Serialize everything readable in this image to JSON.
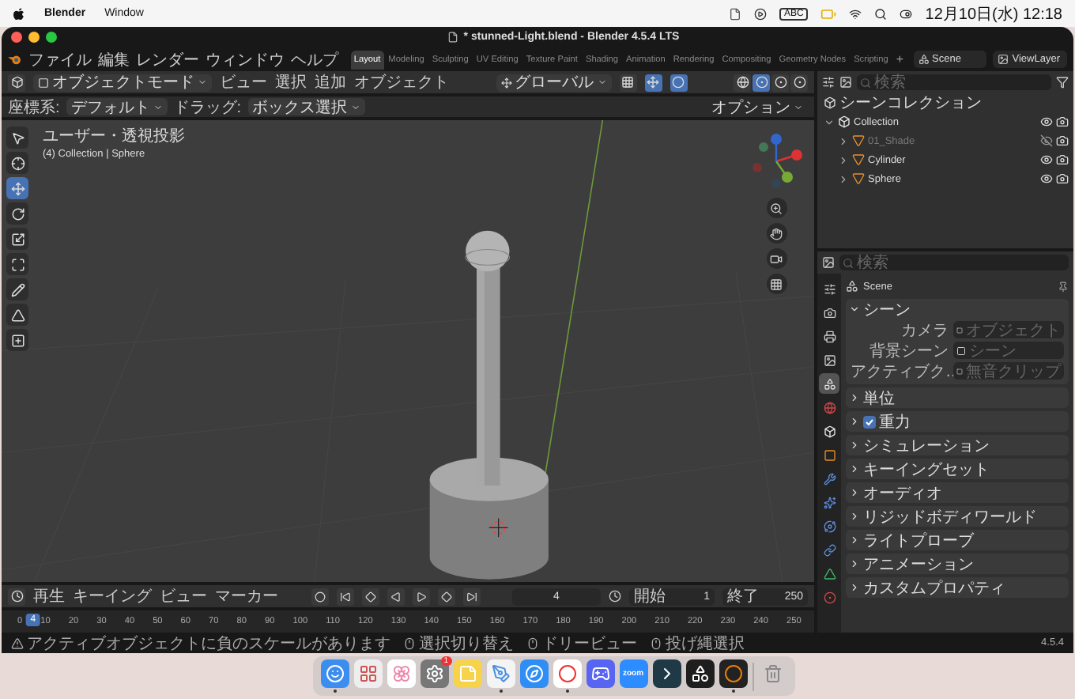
{
  "menubar": {
    "app": "Blender",
    "menus": [
      "Window"
    ],
    "input": "ABC",
    "clock": "12月10日(水) 12:18"
  },
  "window": {
    "title": "* stunned-Light.blend - Blender 4.5.4 LTS"
  },
  "topbar": {
    "menus": [
      "ファイル",
      "編集",
      "レンダー",
      "ウィンドウ",
      "ヘルプ"
    ],
    "workspaces": [
      {
        "label": "Layout",
        "selected": true
      },
      {
        "label": "Modeling",
        "selected": false
      },
      {
        "label": "Sculpting",
        "selected": false
      },
      {
        "label": "UV Editing",
        "selected": false
      },
      {
        "label": "Texture Paint",
        "selected": false
      },
      {
        "label": "Shading",
        "selected": false
      },
      {
        "label": "Animation",
        "selected": false
      },
      {
        "label": "Rendering",
        "selected": false
      },
      {
        "label": "Compositing",
        "selected": false
      },
      {
        "label": "Geometry Nodes",
        "selected": false
      },
      {
        "label": "Scripting",
        "selected": false
      }
    ],
    "add": "+",
    "scene": "Scene",
    "view_layer": "ViewLayer"
  },
  "viewport": {
    "mode": "オブジェクトモード",
    "menus": [
      "ビュー",
      "選択",
      "追加",
      "オブジェクト"
    ],
    "orientation": "グローバル",
    "shading": [
      {
        "kind": "wire",
        "selected": false
      },
      {
        "kind": "solid",
        "selected": true
      },
      {
        "kind": "material",
        "selected": false
      },
      {
        "kind": "rendered",
        "selected": false
      }
    ],
    "tool_settings": {
      "coord_label": "座標系:",
      "coord_value": "デフォルト",
      "drag_label": "ドラッグ:",
      "drag_value": "ボックス選択",
      "options": "オプション"
    },
    "overlay": {
      "view": "ユーザー・透視投影",
      "context": "(4) Collection | Sphere"
    },
    "tools": [
      {
        "kind": "select",
        "selected": false
      },
      {
        "kind": "cursor",
        "selected": false
      },
      {
        "kind": "move",
        "selected": true
      },
      {
        "kind": "rotate",
        "selected": false
      },
      {
        "kind": "scale",
        "selected": false
      },
      {
        "kind": "transform",
        "selected": false
      },
      {
        "kind": "annotate",
        "selected": false
      },
      {
        "kind": "measure",
        "selected": false
      },
      {
        "kind": "add",
        "selected": false
      }
    ]
  },
  "outliner": {
    "search_placeholder": "検索",
    "root": "シーンコレクション",
    "items": [
      {
        "name": "Collection",
        "expanded": true,
        "hidden": false,
        "children": [
          {
            "name": "01_Shade",
            "expanded": false,
            "hidden": true
          },
          {
            "name": "Cylinder",
            "expanded": false,
            "hidden": false
          },
          {
            "name": "Sphere",
            "expanded": false,
            "hidden": false
          }
        ]
      }
    ]
  },
  "properties": {
    "search_placeholder": "検索",
    "context": "Scene",
    "tabs": [
      {
        "kind": "tool",
        "selected": false
      },
      {
        "kind": "render",
        "selected": false
      },
      {
        "kind": "output",
        "selected": false
      },
      {
        "kind": "view_layer",
        "selected": false
      },
      {
        "kind": "scene",
        "selected": true
      },
      {
        "kind": "world",
        "selected": false
      },
      {
        "kind": "collection",
        "selected": false
      },
      {
        "kind": "object",
        "selected": false
      },
      {
        "kind": "modifiers",
        "selected": false
      },
      {
        "kind": "particles",
        "selected": false
      },
      {
        "kind": "physics",
        "selected": false
      },
      {
        "kind": "constraints",
        "selected": false
      },
      {
        "kind": "data",
        "selected": false
      },
      {
        "kind": "material",
        "selected": false
      }
    ],
    "section": {
      "title": "シーン",
      "expanded": true,
      "fields": [
        {
          "label": "カメラ",
          "placeholder": "オブジェクト"
        },
        {
          "label": "背景シーン",
          "placeholder": "シーン"
        },
        {
          "label": "アクティブク…",
          "placeholder": "無音クリップ"
        }
      ]
    },
    "panels": [
      {
        "title": "単位",
        "kind": "plain",
        "expanded": false
      },
      {
        "title": "重力",
        "kind": "checkbox",
        "checked": true,
        "expanded": false
      },
      {
        "title": "シミュレーション",
        "kind": "plain",
        "expanded": false
      },
      {
        "title": "キーイングセット",
        "kind": "plain",
        "expanded": false
      },
      {
        "title": "オーディオ",
        "kind": "plain",
        "expanded": false
      },
      {
        "title": "リジッドボディワールド",
        "kind": "plain",
        "expanded": false
      },
      {
        "title": "ライトプローブ",
        "kind": "plain",
        "expanded": false
      },
      {
        "title": "アニメーション",
        "kind": "plain",
        "expanded": false
      },
      {
        "title": "カスタムプロパティ",
        "kind": "plain",
        "expanded": false
      }
    ]
  },
  "timeline": {
    "menus": [
      "再生",
      "キーイング",
      "ビュー",
      "マーカー"
    ],
    "current_frame": "4",
    "start_label": "開始",
    "start": "1",
    "end_label": "終了",
    "end": "250",
    "playhead": "4",
    "ticks": [
      "0",
      "10",
      "20",
      "30",
      "40",
      "50",
      "60",
      "70",
      "80",
      "90",
      "100",
      "110",
      "120",
      "130",
      "140",
      "150",
      "160",
      "170",
      "180",
      "190",
      "200",
      "210",
      "220",
      "230",
      "240",
      "250"
    ]
  },
  "status_bar": {
    "items": [
      {
        "kind": "warning",
        "text": "アクティブオブジェクトに負のスケールがあります"
      },
      {
        "kind": "mouse",
        "text": "選択切り替え"
      },
      {
        "kind": "mouse",
        "text": "ドリービュー"
      },
      {
        "kind": "mouse",
        "text": "投げ縄選択"
      }
    ],
    "version": "4.5.4"
  },
  "dock": {
    "apps": [
      {
        "kind": "finder",
        "running": true
      },
      {
        "kind": "launchpad",
        "running": false
      },
      {
        "kind": "photos",
        "running": false
      },
      {
        "kind": "settings",
        "running": false,
        "badge": "1"
      },
      {
        "kind": "notes",
        "running": false
      },
      {
        "kind": "freeform",
        "running": true
      },
      {
        "kind": "safari",
        "running": false
      },
      {
        "kind": "chrome",
        "running": true
      },
      {
        "kind": "discord",
        "running": false
      },
      {
        "kind": "zoom",
        "running": false,
        "label": "zoom"
      },
      {
        "kind": "app",
        "running": false
      },
      {
        "kind": "figma",
        "running": false
      },
      {
        "kind": "blender",
        "running": true
      },
      {
        "kind": "trash",
        "running": false
      }
    ]
  }
}
